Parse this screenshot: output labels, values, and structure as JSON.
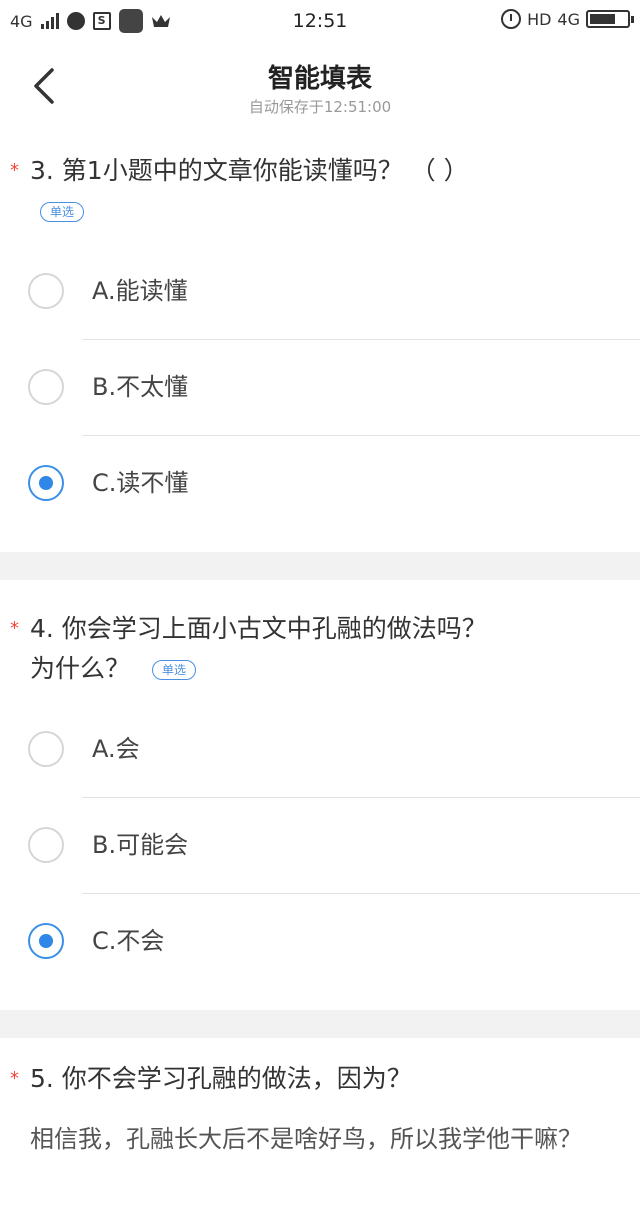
{
  "status_bar": {
    "network": "4G",
    "sim_icon_text": "S",
    "time": "12:51",
    "hd": "HD",
    "net_right": "4G",
    "icons": [
      "signal-icon",
      "app-icon",
      "sim-icon",
      "app-square-icon",
      "crown-icon",
      "alarm-icon",
      "battery-icon"
    ]
  },
  "header": {
    "title": "智能填表",
    "subtitle": "自动保存于12:51:00",
    "back_icon": "chevron-left-icon"
  },
  "questions": [
    {
      "required": "*",
      "title": "3. 第1小题中的文章你能读懂吗？ （ ）",
      "tag": "单选",
      "options": [
        {
          "label": "A.能读懂",
          "checked": false
        },
        {
          "label": "B.不太懂",
          "checked": false
        },
        {
          "label": "C.读不懂",
          "checked": true
        }
      ]
    },
    {
      "required": "*",
      "title_line1": "4. 你会学习上面小古文中孔融的做法吗？",
      "title_line2": "为什么？",
      "tag": "单选",
      "options": [
        {
          "label": "A.会",
          "checked": false
        },
        {
          "label": "B.可能会",
          "checked": false
        },
        {
          "label": "C.不会",
          "checked": true
        }
      ]
    },
    {
      "required": "*",
      "title": "5. 你不会学习孔融的做法，因为？",
      "answer": "相信我，孔融长大后不是啥好鸟，所以我学他干嘛？"
    }
  ],
  "colors": {
    "accent": "#2f88e8",
    "required": "#f5433c",
    "section_gap": "#f2f2f2"
  }
}
